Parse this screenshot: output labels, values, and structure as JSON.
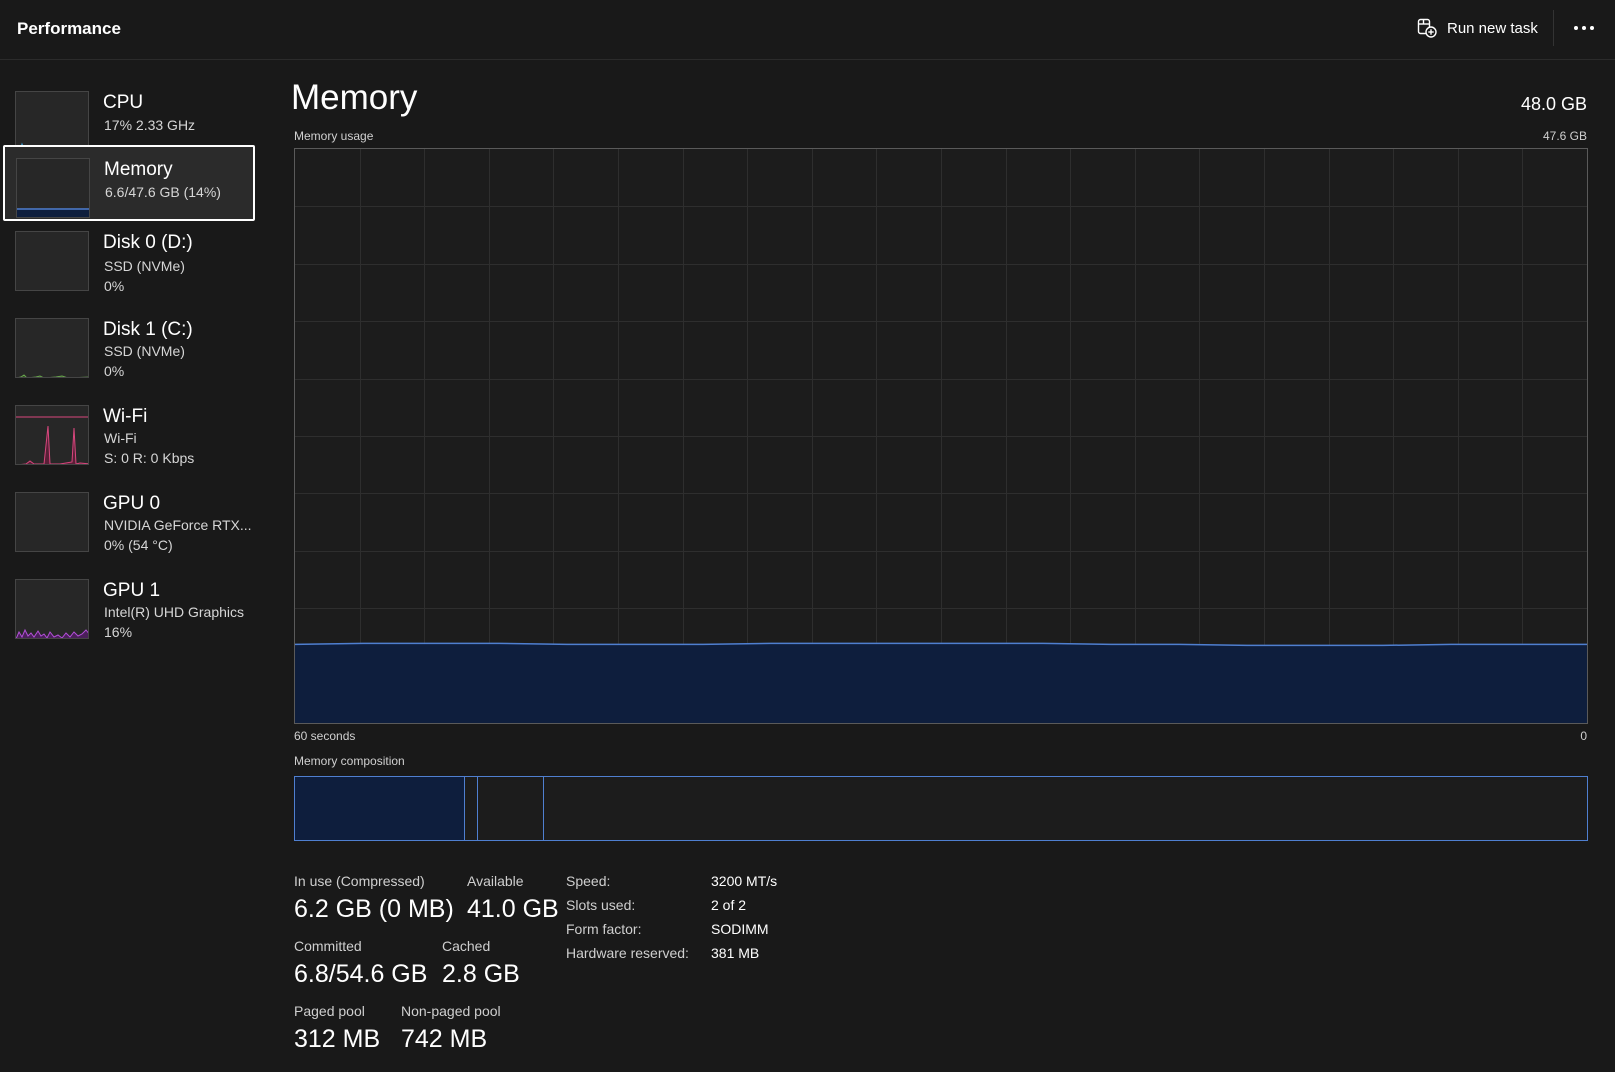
{
  "app": {
    "title": "Performance"
  },
  "toolbar": {
    "run_new_task_label": "Run new task",
    "more_icon": "more-options-icon"
  },
  "sidebar": {
    "items": [
      {
        "title": "CPU",
        "line1": "17%  2.33 GHz",
        "line2": "",
        "accent": "#3aa0d8",
        "selected": false
      },
      {
        "title": "Memory",
        "line1": "6.6/47.6 GB (14%)",
        "line2": "",
        "accent": "#4f7fd0",
        "selected": true
      },
      {
        "title": "Disk 0 (D:)",
        "line1": "SSD (NVMe)",
        "line2": "0%",
        "accent": "#6aa84f",
        "selected": false
      },
      {
        "title": "Disk 1 (C:)",
        "line1": "SSD (NVMe)",
        "line2": "0%",
        "accent": "#6aa84f",
        "selected": false
      },
      {
        "title": "Wi-Fi",
        "line1": "Wi-Fi",
        "line2": "S: 0 R: 0 Kbps",
        "accent": "#d8477e",
        "selected": false
      },
      {
        "title": "GPU 0",
        "line1": "NVIDIA GeForce RTX...",
        "line2": "0%  (54 °C)",
        "accent": "#b34fd8",
        "selected": false
      },
      {
        "title": "GPU 1",
        "line1": "Intel(R) UHD Graphics",
        "line2": "16%",
        "accent": "#b34fd8",
        "selected": false
      }
    ]
  },
  "memory": {
    "title": "Memory",
    "total": "48.0 GB",
    "usage_label": "Memory usage",
    "usage_max": "47.6 GB",
    "time_left": "60 seconds",
    "time_right": "0",
    "composition_label": "Memory composition",
    "usage_fraction": 0.137,
    "composition": {
      "in_use_fraction": 0.131,
      "modified_fraction": 0.009,
      "standby_fraction": 0.05
    },
    "accent": "#4f7fd0"
  },
  "stats": {
    "in_use_label": "In use (Compressed)",
    "in_use_value": "6.2 GB (0 MB)",
    "available_label": "Available",
    "available_value": "41.0 GB",
    "committed_label": "Committed",
    "committed_value": "6.8/54.6 GB",
    "cached_label": "Cached",
    "cached_value": "2.8 GB",
    "paged_label": "Paged pool",
    "paged_value": "312 MB",
    "nonpaged_label": "Non-paged pool",
    "nonpaged_value": "742 MB"
  },
  "specs": {
    "speed_label": "Speed:",
    "speed_value": "3200 MT/s",
    "slots_label": "Slots used:",
    "slots_value": "2 of 2",
    "form_label": "Form factor:",
    "form_value": "SODIMM",
    "reserved_label": "Hardware reserved:",
    "reserved_value": "381 MB"
  }
}
